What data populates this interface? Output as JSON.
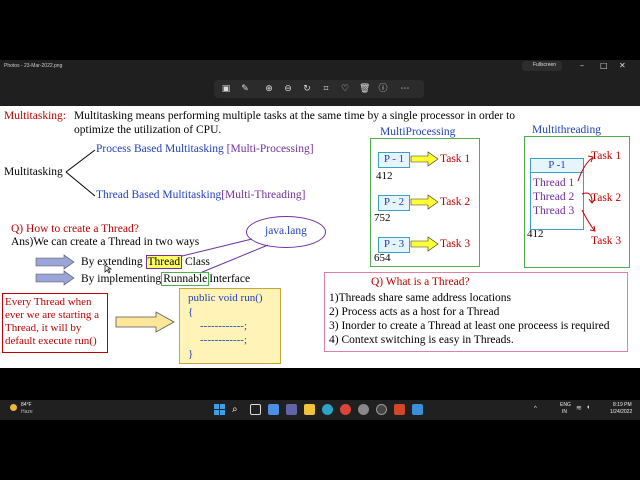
{
  "viewer": {
    "filename": "Photos - 23-Mar-2022.png",
    "fullscreen_label": "Fullscreen",
    "tool_icons": [
      "gallery-icon",
      "edit-icon",
      "crop-icon",
      "zoom-in-icon",
      "zoom-out-icon",
      "rotate-icon",
      "favorite-icon",
      "delete-icon",
      "info-icon",
      "more-icon"
    ]
  },
  "slide": {
    "multitasking_label": "Multitasking:",
    "multitasking_def_1": "Multitasking means performing multiple tasks at the same time by a single processor in order to",
    "multitasking_def_2": "optimize the utilization of CPU.",
    "multitasking": "Multitasking",
    "process_based": "Process Based Multitasking",
    "multi_processing": "[Multi-Processing]",
    "thread_based": "Thread Based Multitasking",
    "multi_threading": "[Multi-Threading]",
    "q_create": "Q) How to create a Thread?",
    "ans": "Ans)We can create a Thread in two ways",
    "java_lang": "java.lang",
    "way1_pre": "By extending",
    "way1_mid": "Thread",
    "way1_post": "Class",
    "way2_pre": "By implementing",
    "way2_mid": "Runnable",
    "way2_post": "Interface",
    "every_thread": [
      "Every Thread  when",
      "ever we are starting a",
      "Thread, it will by",
      "default execute run()"
    ],
    "code": [
      "public void run()",
      "{",
      "------------;",
      "------------;",
      "}"
    ],
    "multiprocessing_title": "MultiProcessing",
    "processes": [
      {
        "label": "P - 1",
        "task": "Task 1",
        "pid": "412"
      },
      {
        "label": "P - 2",
        "task": "Task 2",
        "pid": "752"
      },
      {
        "label": "P - 3",
        "task": "Task 3",
        "pid": "654"
      }
    ],
    "multithreading_title": "Multithreading",
    "mt_process": "P -1",
    "threads": [
      "Thread 1",
      "Thread 2",
      "Thread 3"
    ],
    "mt_tasks": [
      "Task 1",
      "Task 2",
      "Task 3"
    ],
    "mt_pid": "412",
    "q_what": "Q) What is a Thread?",
    "facts": [
      "1)Threads share same address locations",
      "2) Process acts as a host for a Thread",
      "3) Inorder to create a Thread at least one proceess is required",
      "4) Context switching is easy in Threads."
    ]
  },
  "taskbar": {
    "weather_temp": "84°F",
    "weather_desc": "Haze",
    "lang": "ENG",
    "region": "IN",
    "time": "8:19 PM",
    "date": "1/24/2022",
    "apps": [
      "windows-start-icon",
      "search-icon",
      "task-view-icon",
      "widgets-icon",
      "teams-icon",
      "file-explorer-icon",
      "edge-icon",
      "chrome-icon",
      "media-icon",
      "obs-icon",
      "powerpoint-icon",
      "photos-icon"
    ]
  },
  "colors": {
    "red": "#c00000",
    "blue": "#1f3fbf",
    "purple": "#7030a0",
    "teal": "#3aa0c8",
    "green": "#4caf50",
    "pink": "#e07fa8"
  }
}
